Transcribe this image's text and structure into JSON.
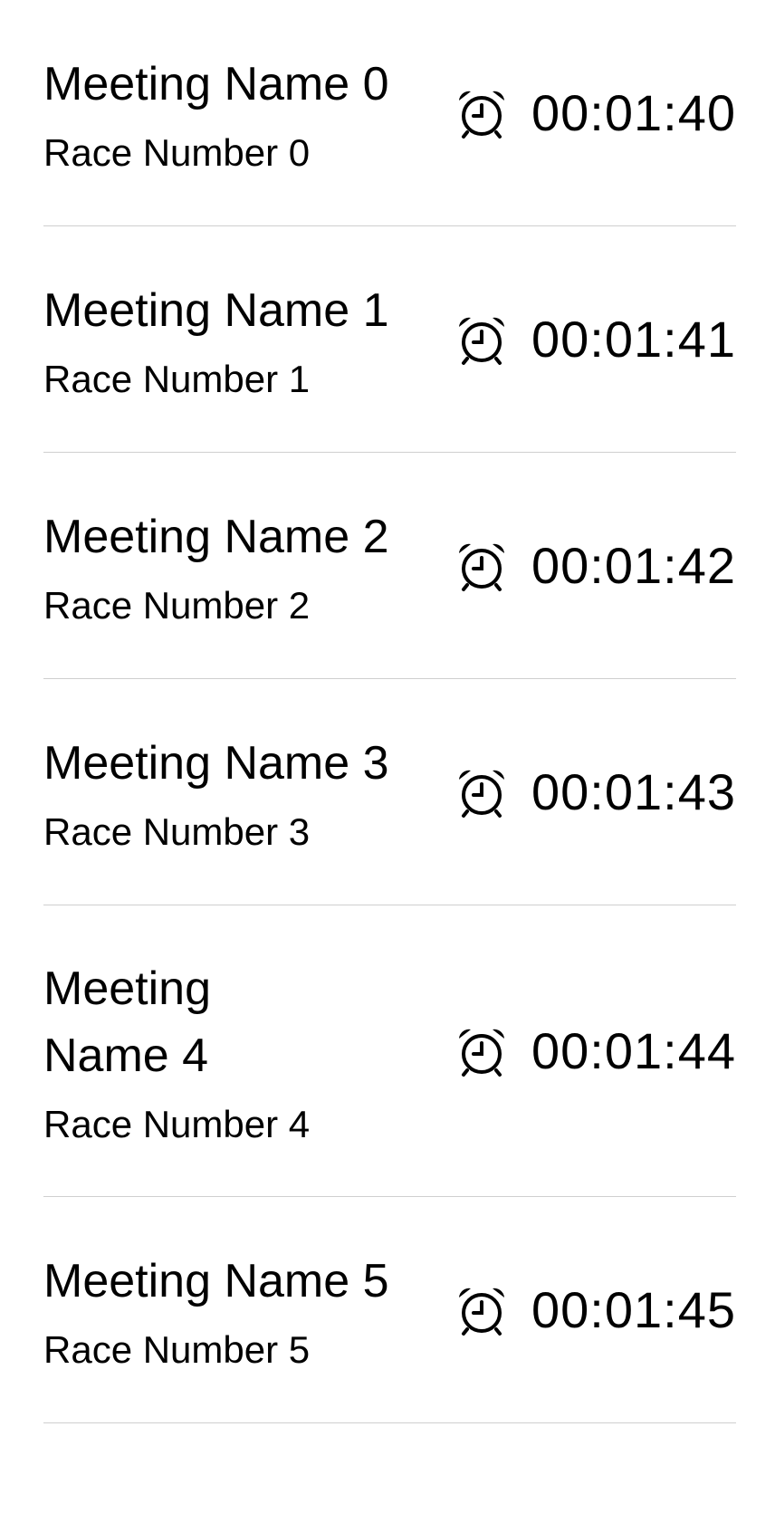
{
  "races": [
    {
      "meeting_name": "Meeting Name 0",
      "race_number": "Race Number 0",
      "countdown": "00:01:40",
      "icon": "alarm-clock-icon"
    },
    {
      "meeting_name": "Meeting Name 1",
      "race_number": "Race Number 1",
      "countdown": "00:01:41",
      "icon": "alarm-clock-icon"
    },
    {
      "meeting_name": "Meeting Name 2",
      "race_number": "Race Number 2",
      "countdown": "00:01:42",
      "icon": "alarm-clock-icon"
    },
    {
      "meeting_name": "Meeting Name 3",
      "race_number": "Race Number 3",
      "countdown": "00:01:43",
      "icon": "alarm-clock-icon"
    },
    {
      "meeting_name": "Meeting Name 4",
      "race_number": "Race Number 4",
      "countdown": "00:01:44",
      "icon": "alarm-clock-icon"
    },
    {
      "meeting_name": "Meeting Name 5",
      "race_number": "Race Number 5",
      "countdown": "00:01:45",
      "icon": "alarm-clock-icon"
    }
  ],
  "colors": {
    "text": "#000000",
    "separator": "#cfcfcf",
    "background": "#ffffff"
  }
}
